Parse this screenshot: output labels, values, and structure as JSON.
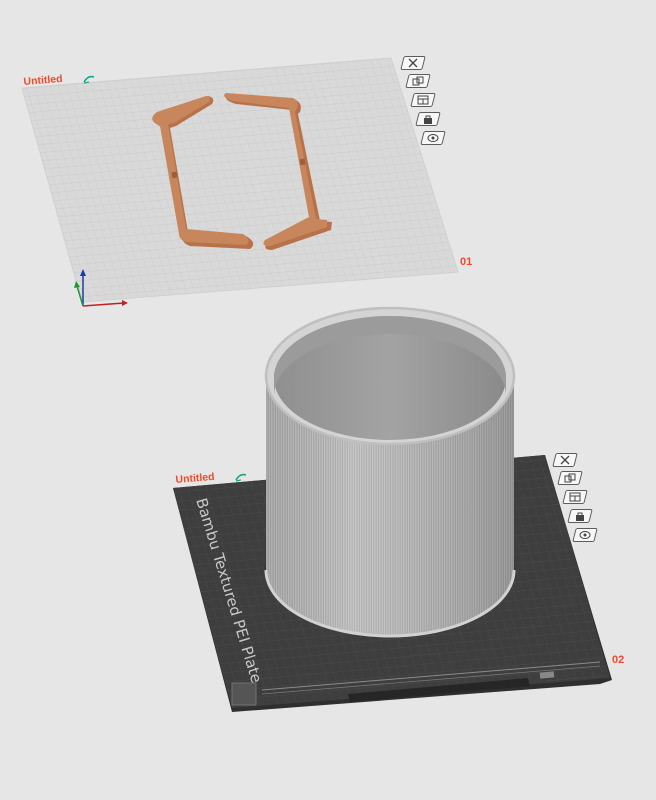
{
  "plates": [
    {
      "name": "Untitled",
      "number": "01",
      "bed_style": "light",
      "tools": [
        {
          "name": "remove-plate-icon"
        },
        {
          "name": "arrange-icon"
        },
        {
          "name": "auto-orient-icon"
        },
        {
          "name": "lock-icon"
        },
        {
          "name": "plate-settings-icon"
        }
      ],
      "object": {
        "type": "bracket-frame",
        "color": "#c8865c"
      }
    },
    {
      "name": "Untitled",
      "number": "02",
      "bed_style": "dark",
      "bed_label": "Bambu Textured PEI Plate",
      "tools": [
        {
          "name": "remove-plate-icon"
        },
        {
          "name": "arrange-icon"
        },
        {
          "name": "auto-orient-icon"
        },
        {
          "name": "lock-icon"
        },
        {
          "name": "plate-settings-icon"
        }
      ],
      "object": {
        "type": "ribbed-cylinder",
        "color": "#b4b4b4"
      }
    }
  ],
  "colors": {
    "background": "#e6e6e6",
    "light_bed": "#d9d9d9",
    "dark_bed": "#3e3e3e",
    "accent": "#ee4b2b",
    "model_orange": "#c8865c",
    "model_gray": "#b4b4b4"
  }
}
